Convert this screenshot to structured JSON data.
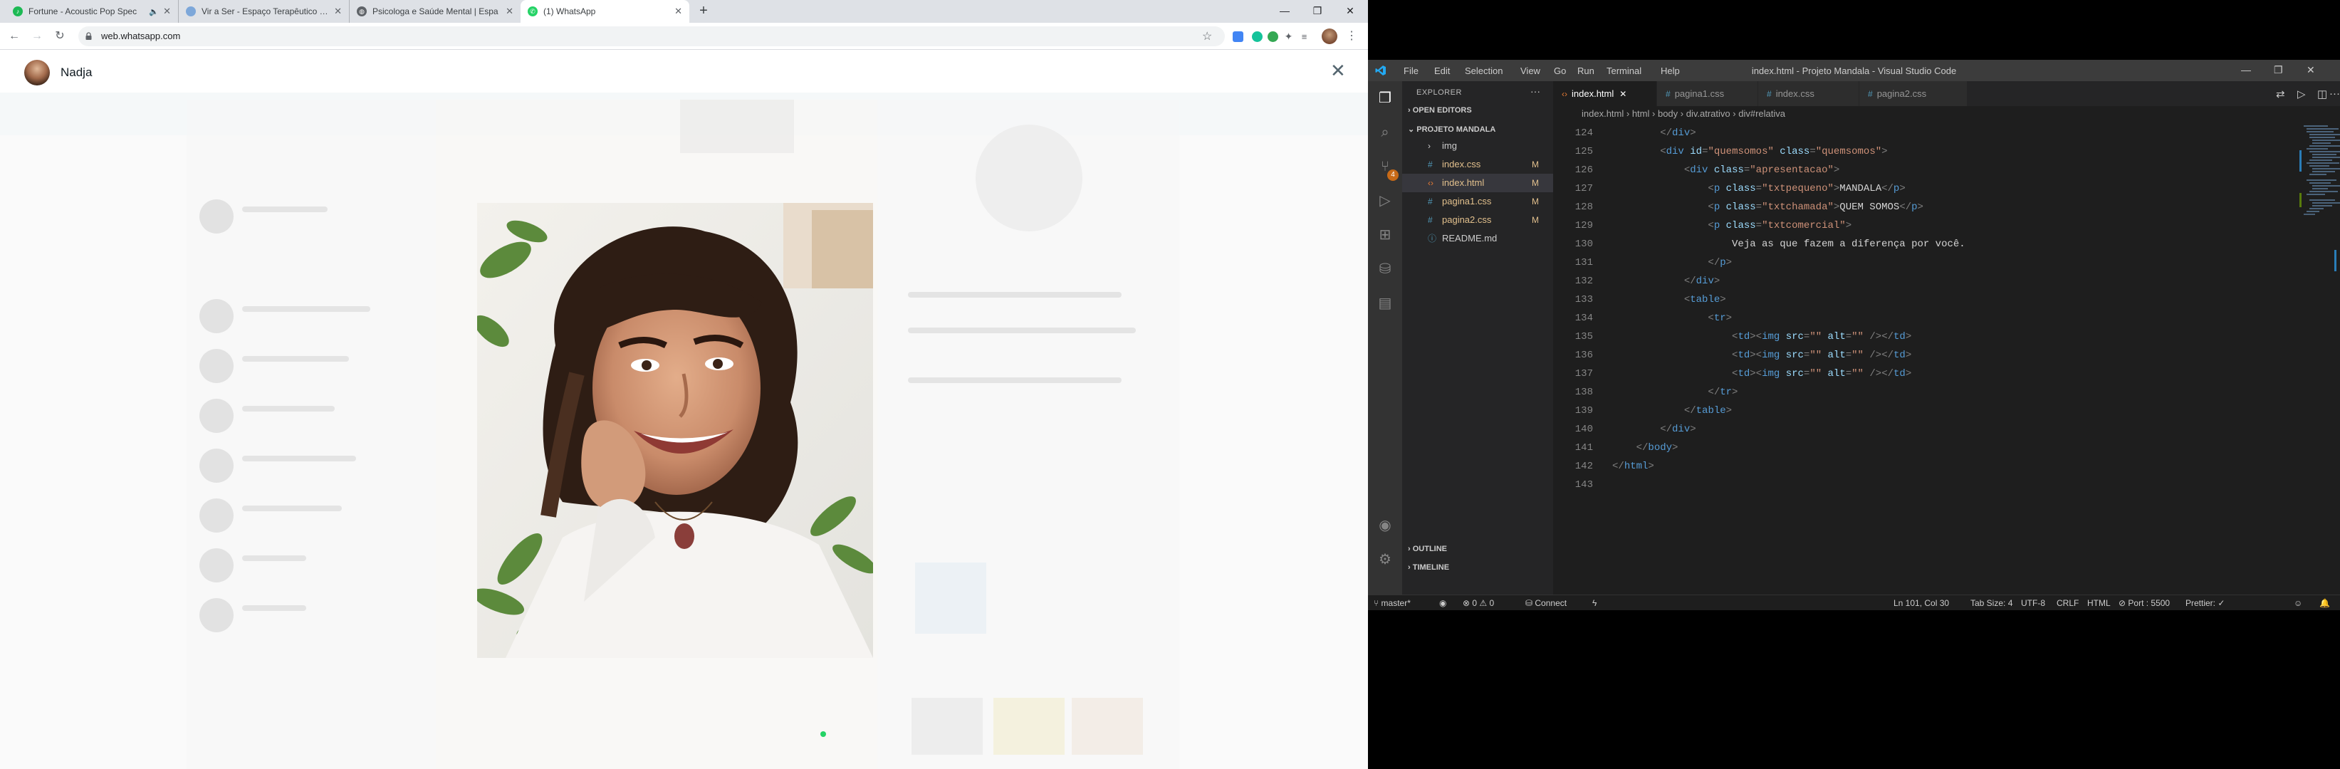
{
  "browser": {
    "tabs": [
      {
        "title": "Fortune - Acoustic Pop Spec",
        "favicon_color": "#1db954",
        "has_audio": true
      },
      {
        "title": "Vir a Ser - Espaço Terapêutico - E",
        "favicon_color": "#7da7d9"
      },
      {
        "title": "Psicologa e Saúde Mental | Espa",
        "favicon_color": "#5f6368"
      },
      {
        "title": "(1) WhatsApp",
        "favicon_color": "#25d366",
        "active": true
      }
    ],
    "url": "web.whatsapp.com",
    "new_tab": "+"
  },
  "viewer": {
    "contact_name": "Nadja",
    "close_symbol": "✕"
  },
  "vscode": {
    "window_title": "index.html - Projeto Mandala - Visual Studio Code",
    "menu": [
      "File",
      "Edit",
      "Selection",
      "View",
      "Go",
      "Run",
      "Terminal",
      "Help"
    ],
    "explorer": {
      "header": "EXPLORER",
      "open_editors": "OPEN EDITORS",
      "project": "PROJETO MANDALA",
      "files": [
        {
          "name": "img",
          "type": "folder",
          "mark": ""
        },
        {
          "name": "index.css",
          "type": "css",
          "mark": "M"
        },
        {
          "name": "index.html",
          "type": "html",
          "mark": "M",
          "selected": true
        },
        {
          "name": "pagina1.css",
          "type": "css",
          "mark": "M"
        },
        {
          "name": "pagina2.css",
          "type": "css",
          "mark": "M"
        },
        {
          "name": "README.md",
          "type": "md",
          "mark": ""
        }
      ],
      "outline": "OUTLINE",
      "timeline": "TIMELINE"
    },
    "tabs": [
      {
        "name": "index.html",
        "active": true
      },
      {
        "name": "pagina1.css"
      },
      {
        "name": "index.css"
      },
      {
        "name": "pagina2.css"
      }
    ],
    "breadcrumbs": [
      "index.html",
      "html",
      "body",
      "div.atrativo",
      "div#relativa"
    ],
    "code_lines": [
      {
        "n": "124",
        "text": "        </div>"
      },
      {
        "n": "125",
        "text": "        <div id=\"quemsomos\" class=\"quemsomos\">"
      },
      {
        "n": "126",
        "text": "            <div class=\"apresentacao\">"
      },
      {
        "n": "127",
        "text": "                <p class=\"txtpequeno\">MANDALA</p>"
      },
      {
        "n": "128",
        "text": "                <p class=\"txtchamada\">QUEM SOMOS</p>"
      },
      {
        "n": "129",
        "text": "                <p class=\"txtcomercial\">"
      },
      {
        "n": "130",
        "text": "                    Veja as que fazem a diferença por você."
      },
      {
        "n": "131",
        "text": "                </p>"
      },
      {
        "n": "132",
        "text": "            </div>"
      },
      {
        "n": "133",
        "text": "            <table>"
      },
      {
        "n": "134",
        "text": "                <tr>"
      },
      {
        "n": "135",
        "text": "                    <td><img src=\"\" alt=\"\" /></td>"
      },
      {
        "n": "136",
        "text": "                    <td><img src=\"\" alt=\"\" /></td>"
      },
      {
        "n": "137",
        "text": "                    <td><img src=\"\" alt=\"\" /></td>"
      },
      {
        "n": "138",
        "text": "                </tr>"
      },
      {
        "n": "139",
        "text": "            </table>"
      },
      {
        "n": "140",
        "text": "        </div>"
      },
      {
        "n": "141",
        "text": "    </body>"
      },
      {
        "n": "142",
        "text": "</html>"
      },
      {
        "n": "143",
        "text": ""
      }
    ],
    "status": {
      "branch": "master*",
      "errors": "0",
      "warnings": "0",
      "connect": "Connect",
      "position": "Ln 101, Col 30",
      "tab_size": "Tab Size: 4",
      "encoding": "UTF-8",
      "eol": "CRLF",
      "language": "HTML",
      "port": "Port : 5500",
      "prettier": "Prettier: ✓"
    }
  }
}
